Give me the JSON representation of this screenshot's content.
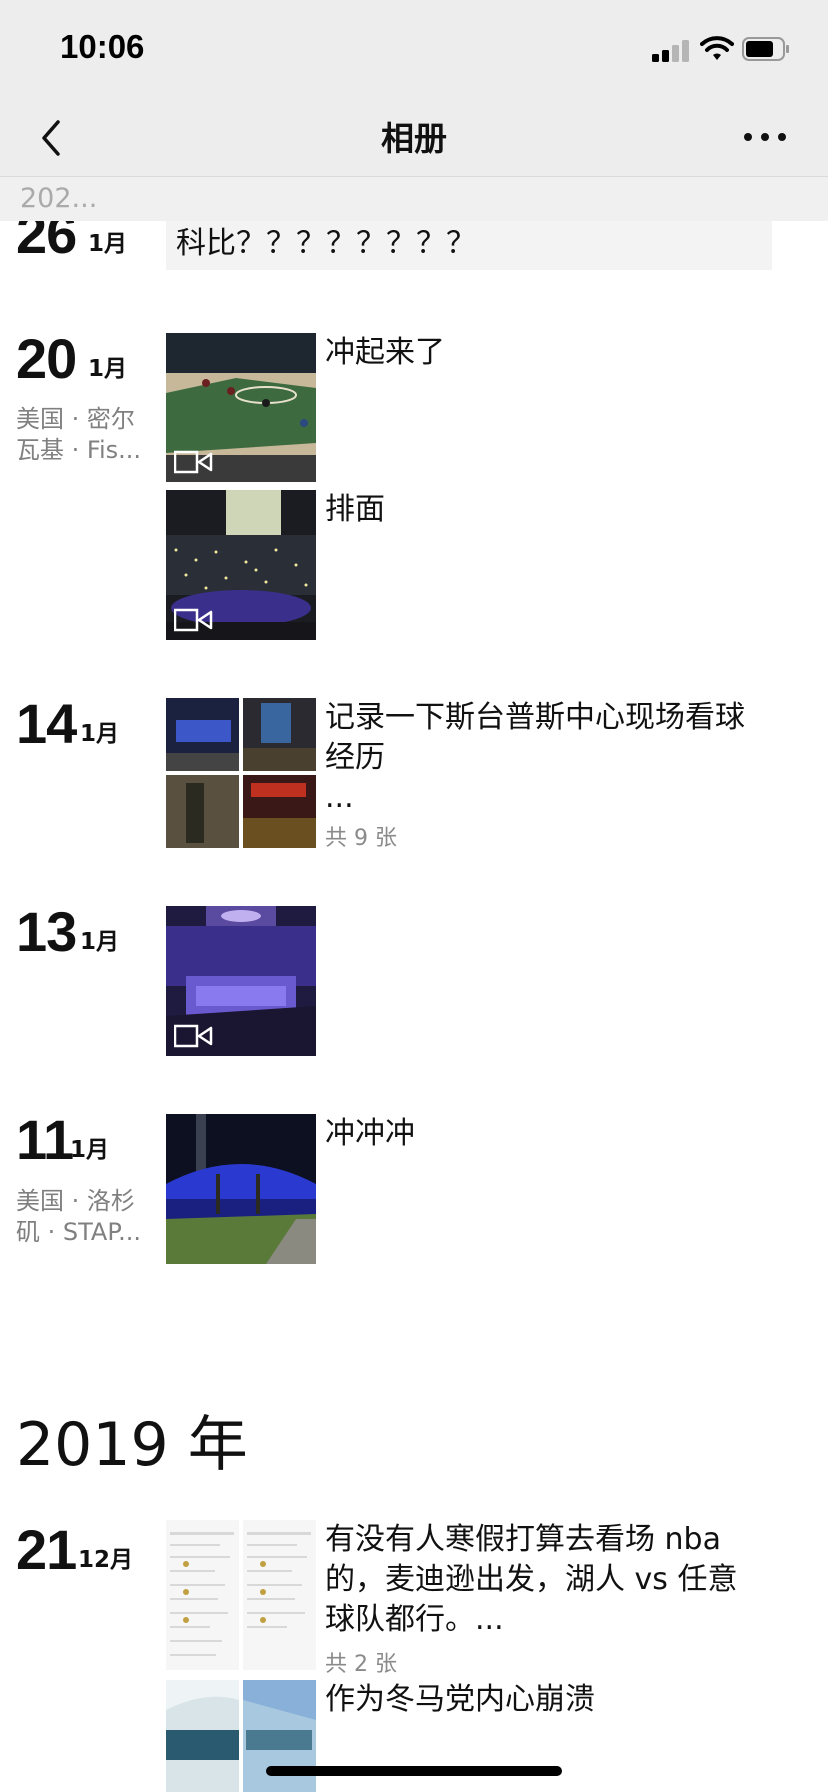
{
  "status": {
    "time": "10:06"
  },
  "nav": {
    "title": "相册",
    "back_icon": "chevron-left-icon",
    "more_icon": "more-dots-icon"
  },
  "sticky_year": "202...",
  "entries": [
    {
      "day": "26",
      "month": "1月",
      "text": "科比？？？？？？？？",
      "type": "text"
    },
    {
      "day": "20",
      "month": "1月",
      "location": "美国 · 密尔瓦基 · Fis...",
      "posts": [
        {
          "text": "冲起来了",
          "type": "video"
        },
        {
          "text": "排面",
          "type": "video"
        }
      ]
    },
    {
      "day": "14",
      "month": "1月",
      "text": "记录一下斯台普斯中心现场看球经历",
      "more": "...",
      "count": "共 9 张",
      "type": "photos"
    },
    {
      "day": "13",
      "month": "1月",
      "text": "",
      "type": "video"
    },
    {
      "day": "11",
      "month": "1月",
      "location": "美国 · 洛杉矶 · STAP...",
      "text": "冲冲冲",
      "type": "photo"
    }
  ],
  "year_header": "2019 年",
  "entries_2019": [
    {
      "day": "21",
      "month": "12月",
      "posts": [
        {
          "text": "有没有人寒假打算去看场 nba 的，麦迪逊出发，湖人 vs 任意球队都行。...",
          "count": "共 2 张",
          "type": "screenshots"
        },
        {
          "text": "作为冬马党内心崩溃",
          "type": "photos"
        }
      ]
    }
  ],
  "colors": {
    "bar_bg": "#ededed",
    "text": "#111111",
    "meta": "#808080",
    "court_green": "#3d6b3f",
    "arena_purple": "#3a2f8a"
  }
}
